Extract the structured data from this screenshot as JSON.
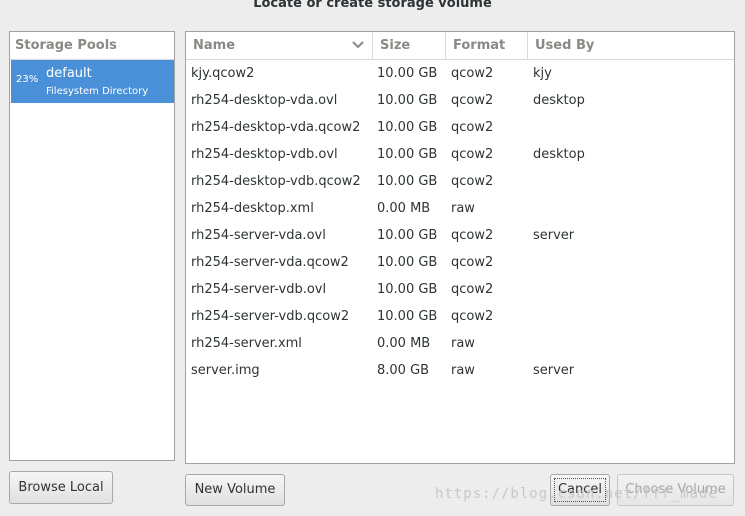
{
  "window": {
    "title": "Locate or create storage volume"
  },
  "pools": {
    "header": "Storage Pools",
    "items": [
      {
        "usage": "23%",
        "name": "default",
        "type": "Filesystem Directory",
        "selected": true
      }
    ]
  },
  "volumes": {
    "columns": {
      "name": "Name",
      "size": "Size",
      "format": "Format",
      "used_by": "Used By"
    },
    "sort_icon": "chevron-down-icon",
    "rows": [
      {
        "name": "kjy.qcow2",
        "size": "10.00 GB",
        "format": "qcow2",
        "used_by": "kjy"
      },
      {
        "name": "rh254-desktop-vda.ovl",
        "size": "10.00 GB",
        "format": "qcow2",
        "used_by": "desktop"
      },
      {
        "name": "rh254-desktop-vda.qcow2",
        "size": "10.00 GB",
        "format": "qcow2",
        "used_by": ""
      },
      {
        "name": "rh254-desktop-vdb.ovl",
        "size": "10.00 GB",
        "format": "qcow2",
        "used_by": "desktop"
      },
      {
        "name": "rh254-desktop-vdb.qcow2",
        "size": "10.00 GB",
        "format": "qcow2",
        "used_by": ""
      },
      {
        "name": "rh254-desktop.xml",
        "size": "0.00 MB",
        "format": "raw",
        "used_by": ""
      },
      {
        "name": "rh254-server-vda.ovl",
        "size": "10.00 GB",
        "format": "qcow2",
        "used_by": "server"
      },
      {
        "name": "rh254-server-vda.qcow2",
        "size": "10.00 GB",
        "format": "qcow2",
        "used_by": ""
      },
      {
        "name": "rh254-server-vdb.ovl",
        "size": "10.00 GB",
        "format": "qcow2",
        "used_by": ""
      },
      {
        "name": "rh254-server-vdb.qcow2",
        "size": "10.00 GB",
        "format": "qcow2",
        "used_by": ""
      },
      {
        "name": "rh254-server.xml",
        "size": "0.00 MB",
        "format": "raw",
        "used_by": ""
      },
      {
        "name": "server.img",
        "size": "8.00 GB",
        "format": "raw",
        "used_by": "server"
      }
    ]
  },
  "buttons": {
    "browse_local": "Browse Local",
    "new_volume": "New Volume",
    "cancel": "Cancel",
    "choose_volume": "Choose Volume"
  },
  "watermark": "https://blog.csdn.net/fff_made",
  "colors": {
    "selection": "#4a90d9",
    "background": "#ededed"
  }
}
